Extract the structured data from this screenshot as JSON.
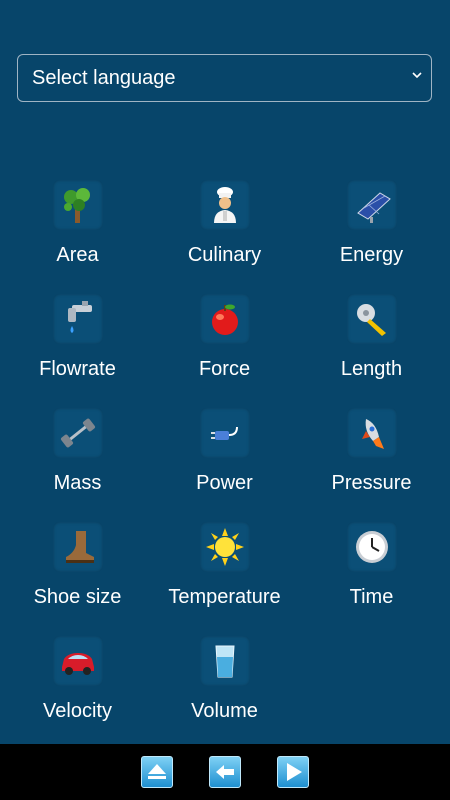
{
  "language_select": {
    "value": "Select language"
  },
  "categories": [
    {
      "label": "Area",
      "icon": "tree-icon"
    },
    {
      "label": "Culinary",
      "icon": "chef-icon"
    },
    {
      "label": "Energy",
      "icon": "solar-panel-icon"
    },
    {
      "label": "Flowrate",
      "icon": "faucet-icon"
    },
    {
      "label": "Force",
      "icon": "apple-icon"
    },
    {
      "label": "Length",
      "icon": "tape-measure-icon"
    },
    {
      "label": "Mass",
      "icon": "dumbbell-icon"
    },
    {
      "label": "Power",
      "icon": "plug-icon"
    },
    {
      "label": "Pressure",
      "icon": "rocket-icon"
    },
    {
      "label": "Shoe size",
      "icon": "boot-icon"
    },
    {
      "label": "Temperature",
      "icon": "sun-icon"
    },
    {
      "label": "Time",
      "icon": "clock-icon"
    },
    {
      "label": "Velocity",
      "icon": "car-icon"
    },
    {
      "label": "Volume",
      "icon": "glass-icon"
    }
  ],
  "bottom_nav": [
    {
      "icon": "eject-icon"
    },
    {
      "icon": "arrow-left-icon"
    },
    {
      "icon": "play-icon"
    }
  ]
}
